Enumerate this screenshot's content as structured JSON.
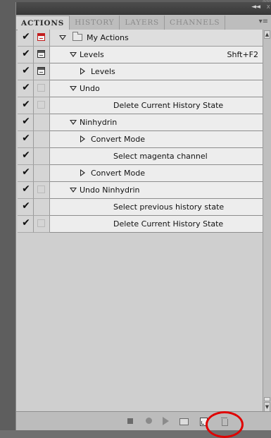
{
  "window": {
    "collapse_glyph": "◄◄",
    "close_glyph": "x",
    "menu_glyph": "▾≡"
  },
  "tabs": [
    {
      "label": "ACTIONS",
      "active": true
    },
    {
      "label": "HISTORY",
      "active": false
    },
    {
      "label": "LAYERS",
      "active": false
    },
    {
      "label": "CHANNELS",
      "active": false
    }
  ],
  "actions": [
    {
      "label": "My Actions",
      "checked": true,
      "dialog": "red",
      "expander": "down",
      "kind": "set"
    },
    {
      "label": "Levels",
      "checked": true,
      "dialog": "box",
      "expander": "down",
      "kind": "action",
      "shortcut": "Shft+F2"
    },
    {
      "label": "Levels",
      "checked": true,
      "dialog": "box",
      "expander": "right",
      "kind": "step"
    },
    {
      "label": "Undo",
      "checked": true,
      "dialog": "faint",
      "expander": "down",
      "kind": "action"
    },
    {
      "label": "Delete Current History State",
      "checked": true,
      "dialog": "faint",
      "expander": "none",
      "kind": "step"
    },
    {
      "label": "Ninhydrin",
      "checked": true,
      "dialog": "none",
      "expander": "down",
      "kind": "action"
    },
    {
      "label": "Convert Mode",
      "checked": true,
      "dialog": "none",
      "expander": "right",
      "kind": "step"
    },
    {
      "label": "Select magenta channel",
      "checked": true,
      "dialog": "none",
      "expander": "none",
      "kind": "step"
    },
    {
      "label": "Convert Mode",
      "checked": true,
      "dialog": "none",
      "expander": "right",
      "kind": "step"
    },
    {
      "label": "Undo Ninhydrin",
      "checked": true,
      "dialog": "faint",
      "expander": "down",
      "kind": "action"
    },
    {
      "label": "Select previous history state",
      "checked": true,
      "dialog": "none",
      "expander": "none",
      "kind": "step"
    },
    {
      "label": "Delete Current History State",
      "checked": true,
      "dialog": "faint",
      "expander": "none",
      "kind": "step"
    }
  ],
  "toolbar": {
    "buttons": [
      "stop-playing-recording",
      "begin-recording",
      "play-selection",
      "create-new-set",
      "create-new-action",
      "delete"
    ]
  },
  "colors": {
    "highlight": "#e00000",
    "panel": "#cfcfcf",
    "row": "#ededed"
  }
}
